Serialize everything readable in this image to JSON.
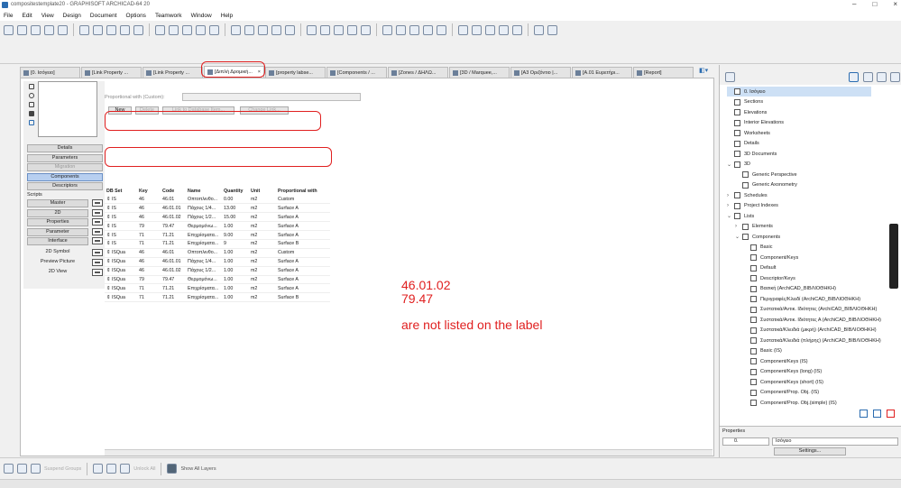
{
  "window": {
    "title": "compositestemplate20 - GRAPHISOFT ARCHICAD-64 20"
  },
  "menu": [
    "File",
    "Edit",
    "View",
    "Design",
    "Document",
    "Options",
    "Teamwork",
    "Window",
    "Help"
  ],
  "tabs": [
    {
      "label": "[0. Ισόγειο]",
      "active": false
    },
    {
      "label": "[Link Property ...",
      "active": false
    },
    {
      "label": "[Link Property ...",
      "active": false
    },
    {
      "label": "[Διπλή Δρομική...",
      "active": true
    },
    {
      "label": "[property labse...",
      "active": false
    },
    {
      "label": "[Components / ...",
      "active": false
    },
    {
      "label": "[Zones / ΔΗΛΩ...",
      "active": false
    },
    {
      "label": "[3D / Marquee,...",
      "active": false
    },
    {
      "label": "[A3 Οριζόντιο |...",
      "active": false
    },
    {
      "label": "[A.01 Ευρετήρι...",
      "active": false
    },
    {
      "label": "[Report]",
      "active": false
    }
  ],
  "left_panel": {
    "nav": [
      {
        "label": "Details",
        "state": "normal"
      },
      {
        "label": "Parameters",
        "state": "normal"
      },
      {
        "label": "Migration",
        "state": "disabled"
      },
      {
        "label": "Components",
        "state": "selected"
      },
      {
        "label": "Descriptors",
        "state": "normal"
      }
    ],
    "scripts_label": "Scripts",
    "scripts": [
      "Master",
      "2D",
      "Properties",
      "Parameter",
      "Interface"
    ],
    "extras": [
      "2D Symbol",
      "Preview Picture",
      "2D View"
    ]
  },
  "content": {
    "buttons": [
      {
        "label": "New",
        "enabled": true
      },
      {
        "label": "Delete",
        "enabled": false
      },
      {
        "label": "Link to Database Item...",
        "enabled": false
      },
      {
        "label": "Change Link...",
        "enabled": false
      }
    ],
    "proportional_label": "Proportional with (Custom):",
    "columns": [
      "DB Set",
      "Key",
      "Code",
      "Name",
      "Quantity",
      "Unit",
      "Proportional with"
    ],
    "rows": [
      [
        "IS",
        "46",
        "46.01",
        "Οπτοπλινθο...",
        "0.00",
        "m2",
        "Custom"
      ],
      [
        "IS",
        "46",
        "46.01.01",
        "Πάχους 1/4...",
        "13.00",
        "m2",
        "Surface A"
      ],
      [
        "IS",
        "46",
        "46.01.02",
        "Πάχους 1/2...",
        "15.00",
        "m2",
        "Surface A"
      ],
      [
        "IS",
        "79",
        "79.47",
        "Θερμομόνω...",
        "1.00",
        "m2",
        "Surface A"
      ],
      [
        "IS",
        "71",
        "71.21",
        "Επιχρίσματα...",
        "9.00",
        "m2",
        "Surface A"
      ],
      [
        "IS",
        "71",
        "71.21",
        "Επιχρίσματα...",
        "9",
        "m2",
        "Surface B"
      ],
      [
        "ISQua",
        "46",
        "46.01",
        "Οπτοπλινθο...",
        "1.00",
        "m2",
        "Custom"
      ],
      [
        "ISQua",
        "46",
        "46.01.01",
        "Πάχους 1/4...",
        "1.00",
        "m2",
        "Surface A"
      ],
      [
        "ISQua",
        "46",
        "46.01.02",
        "Πάχους 1/2...",
        "1.00",
        "m2",
        "Surface A"
      ],
      [
        "ISQua",
        "79",
        "79.47",
        "Θερμομόνω...",
        "1.00",
        "m2",
        "Surface A"
      ],
      [
        "ISQua",
        "71",
        "71.21",
        "Επιχρίσματα...",
        "1.00",
        "m2",
        "Surface A"
      ],
      [
        "ISQua",
        "71",
        "71.21",
        "Επιχρίσματα...",
        "1.00",
        "m2",
        "Surface B"
      ]
    ]
  },
  "annotation": {
    "line1": "46.01.02",
    "line2": "79.47",
    "line3": "are not listed on the label",
    "color": "#e02020"
  },
  "right_panel": {
    "tree": [
      {
        "label": "0. Ισόγειο",
        "level": 1,
        "selected": true,
        "arrow": ""
      },
      {
        "label": "Sections",
        "level": 1,
        "arrow": ""
      },
      {
        "label": "Elevations",
        "level": 1,
        "arrow": ""
      },
      {
        "label": "Interior Elevations",
        "level": 1,
        "arrow": ""
      },
      {
        "label": "Worksheets",
        "level": 1,
        "arrow": ""
      },
      {
        "label": "Details",
        "level": 1,
        "arrow": ""
      },
      {
        "label": "3D Documents",
        "level": 1,
        "arrow": ""
      },
      {
        "label": "3D",
        "level": 1,
        "arrow": "v"
      },
      {
        "label": "Generic Perspective",
        "level": 2,
        "arrow": ""
      },
      {
        "label": "Generic Axonometry",
        "level": 2,
        "arrow": ""
      },
      {
        "label": "Schedules",
        "level": 1,
        "arrow": ">"
      },
      {
        "label": "Project Indexes",
        "level": 1,
        "arrow": ">"
      },
      {
        "label": "Lists",
        "level": 1,
        "arrow": "v"
      },
      {
        "label": "Elements",
        "level": 2,
        "arrow": ">"
      },
      {
        "label": "Components",
        "level": 2,
        "arrow": "v"
      },
      {
        "label": "Basic",
        "level": 3,
        "arrow": ""
      },
      {
        "label": "Component/Keys",
        "level": 3,
        "arrow": ""
      },
      {
        "label": "Default",
        "level": 3,
        "arrow": ""
      },
      {
        "label": "Descriptor/Keys",
        "level": 3,
        "arrow": ""
      },
      {
        "label": "Βασική (ArchiCAD_ΒΙΒΛΙΟΘΗΚΗ)",
        "level": 3,
        "arrow": ""
      },
      {
        "label": "Περιγραφές/Κλειδί (ArchiCAD_ΒΙΒΛΙΟΘΗΚΗ)",
        "level": 3,
        "arrow": ""
      },
      {
        "label": "Συστατικά/Αντικ. Ιδιότητες (ArchiCAD_ΒΙΒΛΙΟΘΗΚΗ)",
        "level": 3,
        "arrow": ""
      },
      {
        "label": "Συστατικά/Αντικ. Ιδιότητες Α (ArchiCAD_ΒΙΒΛΙΟΘΗΚΗ)",
        "level": 3,
        "arrow": ""
      },
      {
        "label": "Συστατικά/Κλειδιά (μικρή) (ArchiCAD_ΒΙΒΛΙΟΘΗΚΗ)",
        "level": 3,
        "arrow": ""
      },
      {
        "label": "Συστατικά/Κλειδιά (πλήρης) (ArchiCAD_ΒΙΒΛΙΟΘΗΚΗ)",
        "level": 3,
        "arrow": ""
      },
      {
        "label": "Basic (IS)",
        "level": 3,
        "arrow": ""
      },
      {
        "label": "Component/Keys (IS)",
        "level": 3,
        "arrow": ""
      },
      {
        "label": "Component/Keys (long) (IS)",
        "level": 3,
        "arrow": ""
      },
      {
        "label": "Component/Keys (short) (IS)",
        "level": 3,
        "arrow": ""
      },
      {
        "label": "Component/Prop. Obj. (IS)",
        "level": 3,
        "arrow": ""
      },
      {
        "label": "Component/Prop. Obj.(simple) (IS)",
        "level": 3,
        "arrow": ""
      }
    ],
    "properties_label": "Properties",
    "prop_id": "0.",
    "prop_name": "Ισόγειο",
    "settings_label": "Settings..."
  },
  "status": {
    "suspend_groups": "Suspend Groups",
    "unlock_all": "Unlock All",
    "show_all_layers": "Show All Layers"
  }
}
